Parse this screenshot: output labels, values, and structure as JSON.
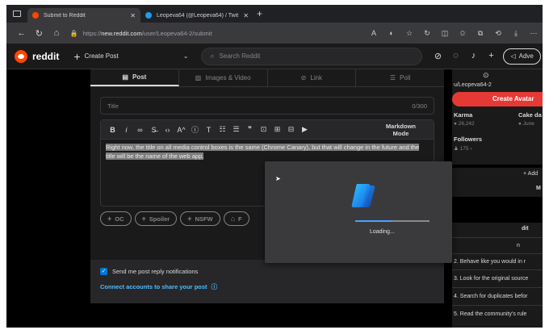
{
  "browser": {
    "tabs": [
      {
        "label": "Submit to Reddit",
        "active": true,
        "favicon_color": "#ff4500"
      },
      {
        "label": "Leopeva64 (@Leopeva64) / Twit",
        "active": false,
        "favicon_color": "#1d9bf0"
      }
    ],
    "url_prefix": "https://",
    "url_domain": "new.reddit.com",
    "url_path": "/user/Leopeva64-2/submit"
  },
  "reddit": {
    "wordmark": "reddit",
    "create_post": "Create Post",
    "search_placeholder": "Search Reddit",
    "advertise": "Adve"
  },
  "post_form": {
    "tabs": [
      {
        "label": "Post",
        "icon": "document-icon"
      },
      {
        "label": "Images & Video",
        "icon": "image-icon"
      },
      {
        "label": "Link",
        "icon": "link-icon"
      },
      {
        "label": "Poll",
        "icon": "poll-icon"
      }
    ],
    "title_placeholder": "Title",
    "title_counter": "0/300",
    "markdown_mode_line1": "Markdown",
    "markdown_mode_line2": "Mode",
    "body_text": "Right now, the title on all media control boxes is the same (Chrome Canary), but that will change in the future and the title will be the name of the web app.",
    "flairs": [
      "OC",
      "Spoiler",
      "NSFW",
      "F"
    ],
    "notification_label": "Send me post reply notifications",
    "connect_label": "Connect accounts to share your post"
  },
  "sidebar": {
    "username": "u/Leopeva64-2",
    "avatar_button": "Create Avatar",
    "karma_label": "Karma",
    "karma_value": "26,242",
    "cake_label": "Cake da",
    "cake_value": "June",
    "followers_label": "Followers",
    "followers_value": "175",
    "mod_add": "+ Add",
    "mod_m": "M",
    "rules_header": "dit",
    "rules": [
      "n",
      "2. Behave like you would in r",
      "3. Look for the original source",
      "4. Search for duplicates befor",
      "5. Read the community's rule"
    ]
  },
  "overlay": {
    "loading_text": "Loading...",
    "progress": 0.5
  }
}
